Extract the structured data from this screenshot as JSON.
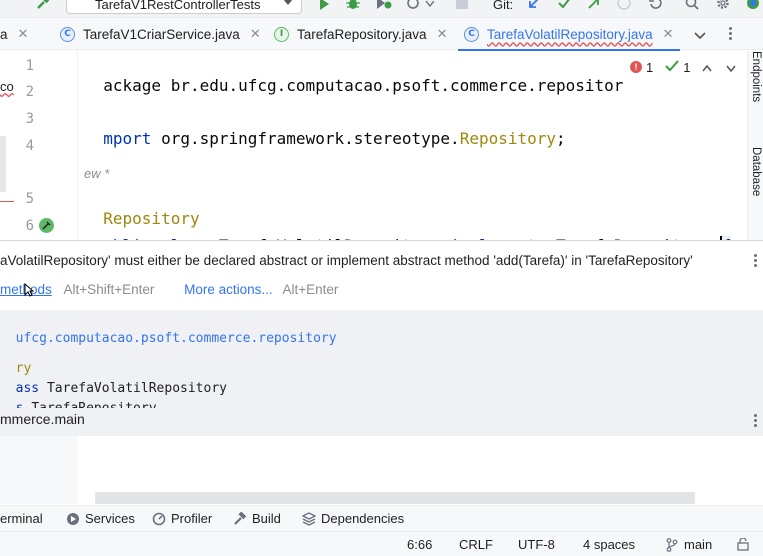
{
  "toolbar": {
    "run_config": "TarefaV1RestControllerTests",
    "git_label": "Git:"
  },
  "tabs": [
    {
      "label": "a",
      "icon": "none",
      "active": false
    },
    {
      "label": "TarefaV1CriarService.java",
      "icon": "C",
      "active": false
    },
    {
      "label": "TarefaRepository.java",
      "icon": "I",
      "active": false
    },
    {
      "label": "TarefaVolatilRepository.java",
      "icon": "C",
      "active": true
    }
  ],
  "editor": {
    "line_numbers": [
      "1",
      "2",
      "3",
      "4",
      "5",
      "6"
    ],
    "line1": "ackage br.edu.ufcg.computacao.psoft.commerce.repositor",
    "line3_kw": "mport",
    "line3_rest": " org.springframework.stereotype.",
    "line3_ann": "Repository",
    "line3_end": ";",
    "hint": "ew *",
    "line5": "Repository",
    "line6_kw": "ublic class",
    "line6_name": "TarefaVolatilRepository",
    "line6_impl": "implements",
    "line6_iface": "TarefaRepository",
    "line6_brace": "{",
    "error_count": "1",
    "warning_count": "1",
    "left_cut": "co"
  },
  "popup": {
    "message": "aVolatilRepository' must either be declared abstract or implement abstract method 'add(Tarefa)' in 'TarefaRepository'",
    "action1": "methods",
    "action1_shortcut": "Alt+Shift+Enter",
    "action2": "More actions...",
    "action2_shortcut": "Alt+Enter",
    "doc_package": "ufcg.computacao.psoft.commerce.repository",
    "doc_annotation": "ry",
    "doc_class_kw": "ass",
    "doc_class_name": "TarefaVolatilRepository",
    "doc_impl_kw": "s",
    "doc_impl_name": "TarefaRepository",
    "module": "mmerce.main"
  },
  "right_stripe": {
    "endpoints": "Endpoints",
    "database": "Database"
  },
  "tool_windows": {
    "terminal": "erminal",
    "services": "Services",
    "profiler": "Profiler",
    "build": "Build",
    "dependencies": "Dependencies"
  },
  "status": {
    "position": "6:66",
    "line_sep": "CRLF",
    "encoding": "UTF-8",
    "indent": "4 spaces",
    "branch": "main"
  },
  "colors": {
    "accent": "#3574f0",
    "keyword": "#0033b3",
    "annotation": "#9e880d",
    "error": "#e05555",
    "run_green": "#5fb865"
  }
}
